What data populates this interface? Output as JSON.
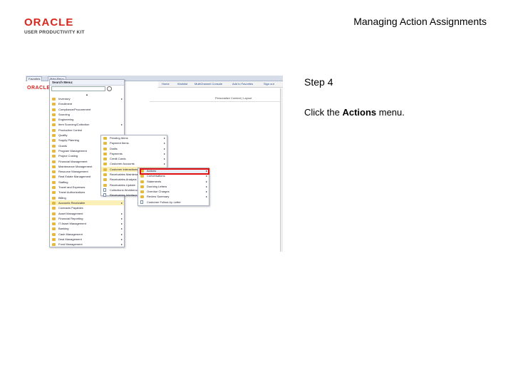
{
  "slide": {
    "title": "Managing Action Assignments",
    "logo_primary": "ORACLE",
    "logo_secondary": "USER PRODUCTIVITY KIT"
  },
  "screenshot": {
    "tabs": [
      "Favorites",
      "Main Menu"
    ],
    "top_links": [
      "Home",
      "Worklist",
      "MultiChannel Console",
      "Add to Favorites",
      "Sign out"
    ],
    "logo": "ORACLE",
    "personalize": "Personalize Content | Layout",
    "menu_title": "Search Menu:",
    "menu_items": [
      "Inventory",
      "Enrollment",
      "Compliance/Procurement",
      "Sourcing",
      "Engineering",
      "Item Sourcing/Collection",
      "Production Control",
      "Quality",
      "Supply Planning",
      "Grants",
      "Program Management",
      "Project Costing",
      "Financial Management",
      "Maintenance Management",
      "Resource Management",
      "Real Estate Management",
      "Staffing",
      "Travel and Expenses",
      "Travel Authorizations",
      "Billing",
      "Accounts Receivable",
      "Contracts Payables",
      "Asset Management",
      "Financial Reporting",
      "IT Asset Management",
      "Banking",
      "Cash Management",
      "Deal Management",
      "Fund Management"
    ],
    "highlighted_menu_item": "Accounts Receivable",
    "submenu_items": [
      "Pending Items",
      "Payment Items",
      "Drafts",
      "Payments",
      "Credit Cards",
      "Customer Accounts",
      "Customer Interactions",
      "Receivables Maintenance",
      "Receivables Analysis",
      "Receivables Update",
      "Collections Workbench",
      "Receivables Interface Set Tasks"
    ],
    "highlighted_submenu_item": "Customer Interactions",
    "actions_items": [
      "Actions",
      "Conversations",
      "Statements",
      "Dunning Letters",
      "Overdue Charges",
      "Review Summary",
      "Customer Follow-Up Letter"
    ],
    "selected_action_item": "Actions"
  },
  "step": {
    "label": "Step 4",
    "instruction_prefix": "Click the ",
    "instruction_bold": "Actions",
    "instruction_suffix": " menu."
  },
  "colors": {
    "oracle_red": "#d7261e",
    "highlight": "#fbf0b8",
    "callout_red": "#e01010"
  }
}
